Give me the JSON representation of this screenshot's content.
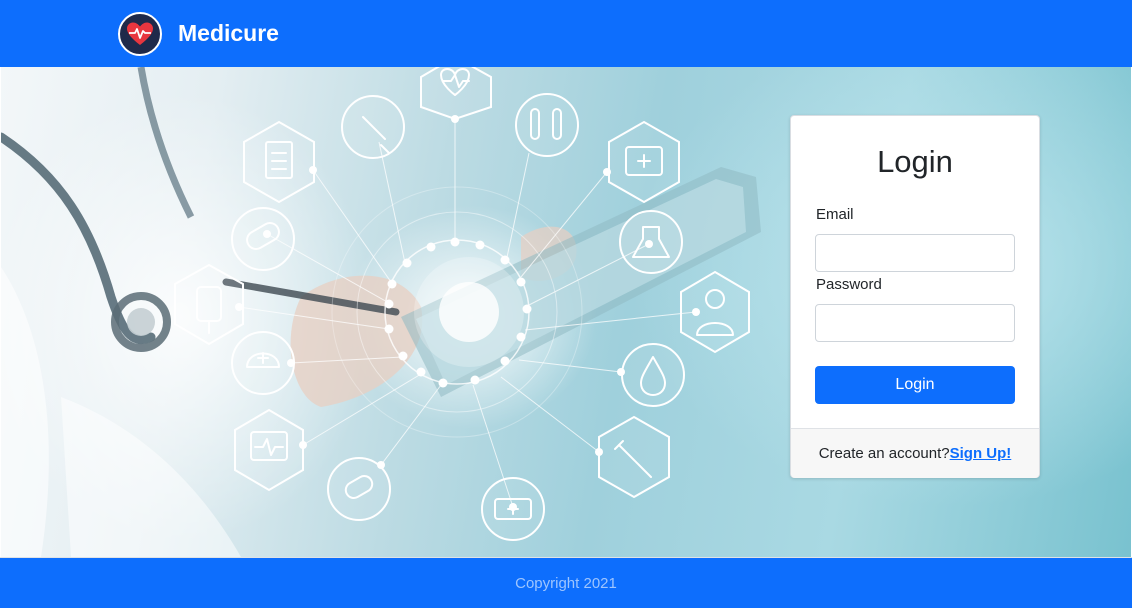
{
  "navbar": {
    "brand": "Medicure",
    "logo_icon": "heart-pulse-icon",
    "colors": {
      "bg": "#0d6efd",
      "logo_bg": "#1f2a4a",
      "heart": "#e8363f"
    }
  },
  "hero": {
    "description_icons": [
      "heart-rate-icon",
      "syringe-icon",
      "test-tubes-icon",
      "clipboard-icon",
      "first-aid-kit-icon",
      "pills-icon",
      "flask-icon",
      "iv-bag-icon",
      "doctor-icon",
      "nurse-cap-icon",
      "blood-drop-icon",
      "monitor-icon",
      "capsule-icon",
      "injection-icon",
      "ambulance-icon"
    ]
  },
  "login": {
    "title": "Login",
    "email_label": "Email",
    "email_value": "",
    "password_label": "Password",
    "password_value": "",
    "submit_label": "Login",
    "footer_text": "Create an account?",
    "signup_link": "Sign Up!"
  },
  "footer": {
    "copyright": "Copyright 2021"
  }
}
